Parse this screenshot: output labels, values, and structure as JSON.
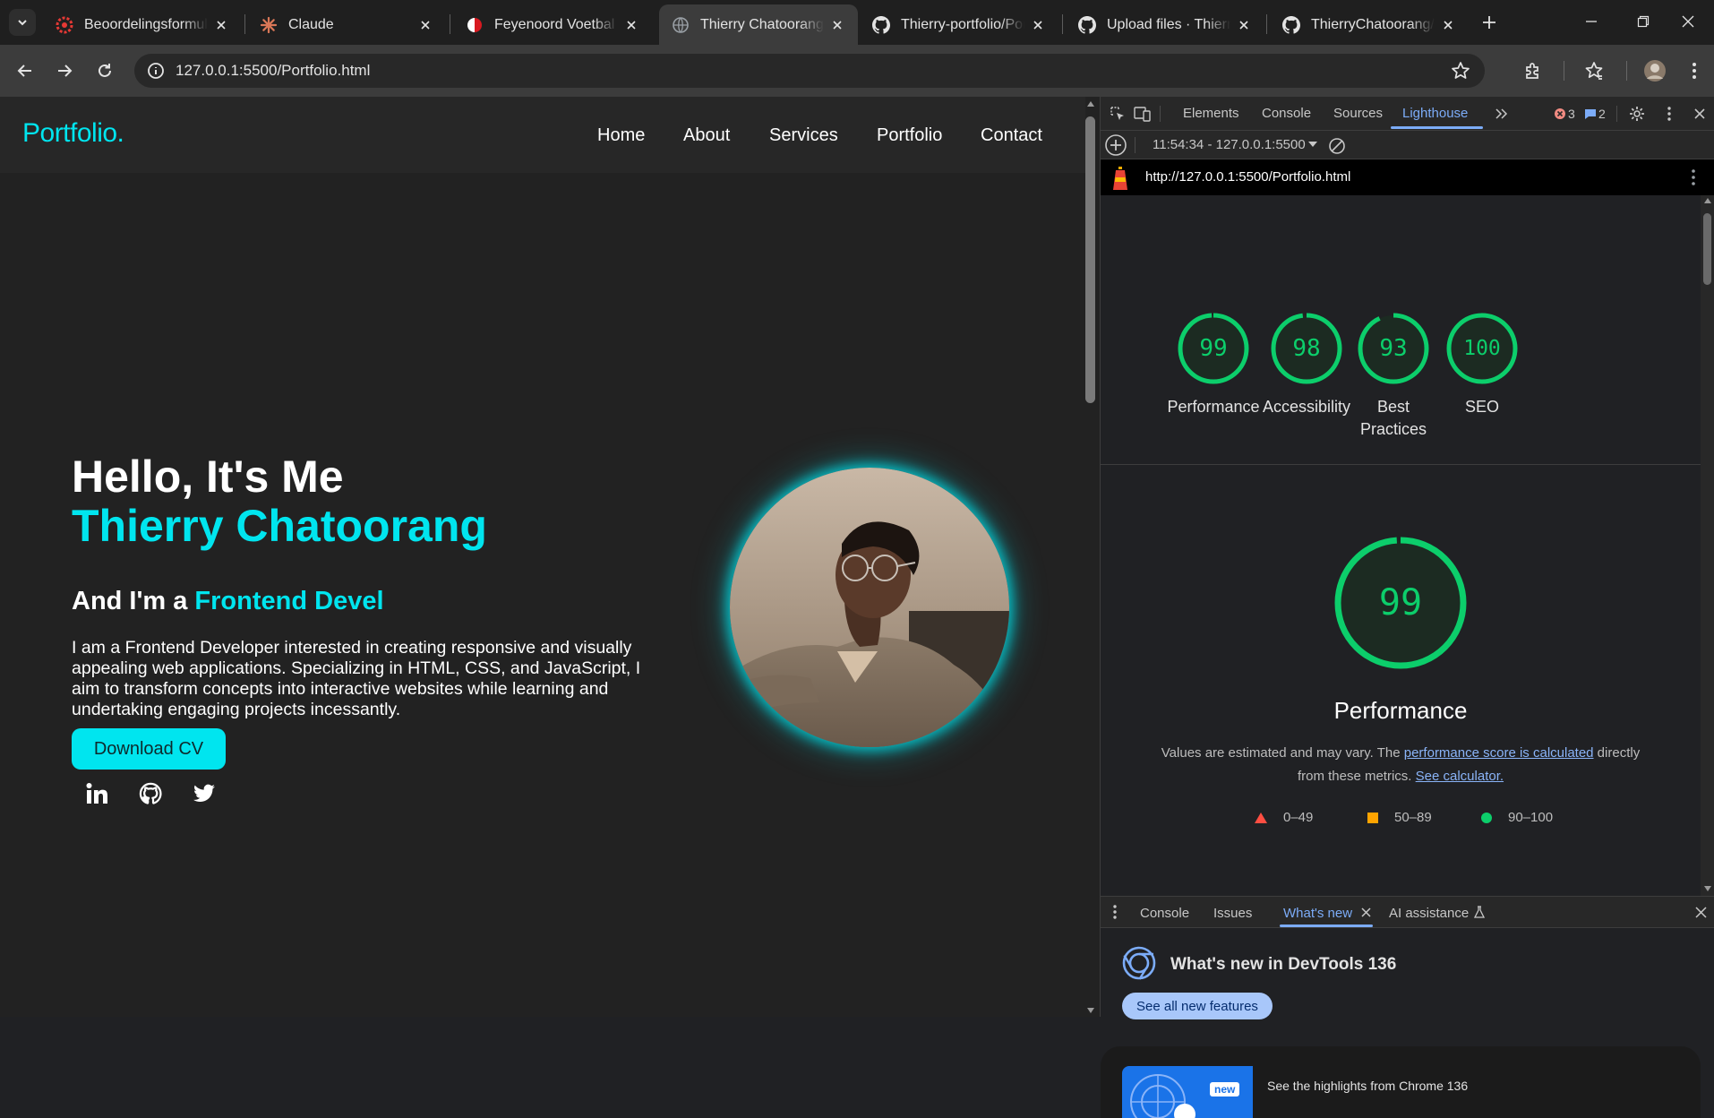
{
  "browser": {
    "tabs": [
      {
        "title": "Beoordelingsformulier",
        "icon": "rubric-favicon",
        "active": false
      },
      {
        "title": "Claude",
        "icon": "claude-favicon",
        "active": false
      },
      {
        "title": "Feyenoord Voetbal - ",
        "icon": "feyenoord-favicon",
        "active": false
      },
      {
        "title": "Thierry Chatoorang - ",
        "icon": "globe-favicon",
        "active": true
      },
      {
        "title": "Thierry-portfolio/Por",
        "icon": "github-favicon",
        "active": false
      },
      {
        "title": "Upload files · Thierry",
        "icon": "github-favicon",
        "active": false
      },
      {
        "title": "ThierryChatoorang/p",
        "icon": "github-favicon",
        "active": false
      }
    ],
    "url": "127.0.0.1:5500/Portfolio.html"
  },
  "site": {
    "brand": "Portfolio.",
    "nav": [
      "Home",
      "About",
      "Services",
      "Portfolio",
      "Contact"
    ],
    "hero": {
      "greeting": "Hello, It's Me",
      "name": "Thierry Chatoorang",
      "role_prefix": "And I'm a ",
      "role_typed": "Frontend Devel",
      "bio": "I am a Frontend Developer interested in creating responsive and visually appealing web applications. Specializing in HTML, CSS, and JavaScript, I aim to transform concepts into interactive websites while learning and undertaking engaging projects incessantly.",
      "cv_button": "Download CV",
      "socials": [
        "linkedin-icon",
        "github-icon",
        "twitter-icon"
      ]
    },
    "accent_color": "#00e5ef"
  },
  "devtools": {
    "tabs": [
      "Elements",
      "Console",
      "Sources",
      "Lighthouse"
    ],
    "active_tab": "Lighthouse",
    "errors_count": "3",
    "messages_count": "2",
    "lighthouse": {
      "report_selector": "11:54:34 - 127.0.0.1:5500",
      "report_url": "http://127.0.0.1:5500/Portfolio.html",
      "scores": [
        {
          "value": 99,
          "label": "Performance"
        },
        {
          "value": 98,
          "label": "Accessibility"
        },
        {
          "value": 93,
          "label": "Best Practices"
        },
        {
          "value": 100,
          "label": "SEO"
        }
      ],
      "performance": {
        "score": 99,
        "title": "Performance",
        "desc_prefix": "Values are estimated and may vary. The ",
        "desc_link1": "performance score is calculated",
        "desc_mid": " directly from these metrics. ",
        "desc_link2": "See calculator."
      },
      "legend": [
        {
          "range": "0–49",
          "color": "#ff4e42"
        },
        {
          "range": "50–89",
          "color": "#ffa400"
        },
        {
          "range": "90–100",
          "color": "#0cce6b"
        }
      ]
    },
    "drawer": {
      "tabs": [
        "Console",
        "Issues",
        "What's new",
        "AI assistance"
      ],
      "active_tab": "What's new",
      "whats_new_title": "What's new in DevTools 136",
      "see_all_button": "See all new features",
      "highlight_badge": "new",
      "highlight_text": "See the highlights from Chrome 136"
    }
  }
}
